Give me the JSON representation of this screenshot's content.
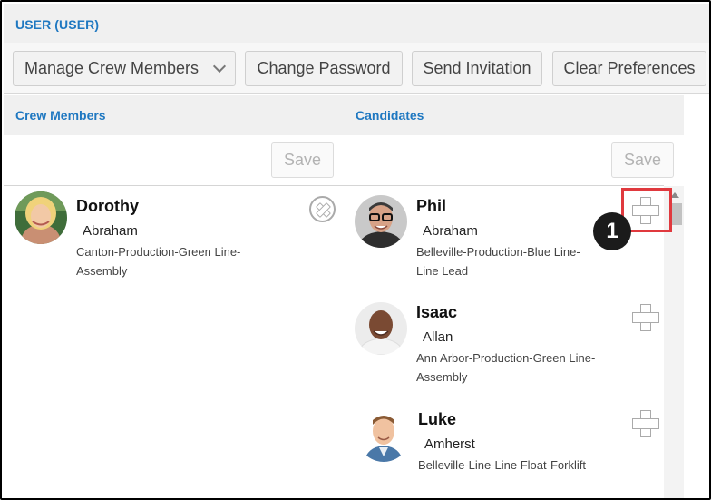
{
  "header": {
    "title": "USER (USER)"
  },
  "toolbar": {
    "manage_label": "Manage Crew Members",
    "change_password_label": "Change Password",
    "send_invitation_label": "Send Invitation",
    "clear_preferences_label": "Clear Preferences"
  },
  "crew": {
    "heading": "Crew Members",
    "save_label": "Save",
    "members": [
      {
        "first": "Dorothy",
        "last": "Abraham",
        "desc": "Canton-Production-Green Line-Assembly"
      }
    ]
  },
  "candidates": {
    "heading": "Candidates",
    "save_label": "Save",
    "items": [
      {
        "first": "Phil",
        "last": "Abraham",
        "desc": "Belleville-Production-Blue Line-Line Lead"
      },
      {
        "first": "Isaac",
        "last": "Allan",
        "desc": "Ann Arbor-Production-Green Line-Assembly"
      },
      {
        "first": "Luke",
        "last": "Amherst",
        "desc": "Belleville-Line-Line Float-Forklift"
      }
    ]
  },
  "callout": {
    "number": "1"
  },
  "colors": {
    "accent": "#1f78c1",
    "highlight": "#e0393e"
  },
  "icons": {
    "add": "plus-icon",
    "remove": "remove-circle-icon",
    "dropdown": "chevron-down-icon"
  }
}
